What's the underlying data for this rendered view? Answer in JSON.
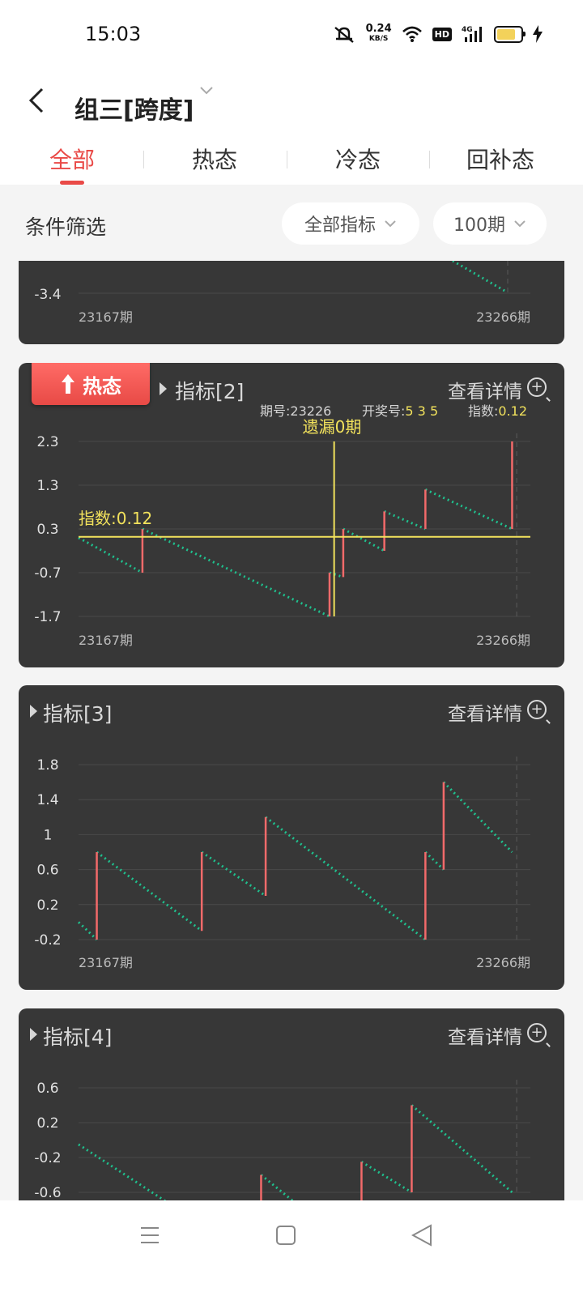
{
  "status_bar": {
    "time": "15:03",
    "net_speed": "0.24",
    "net_unit": "KB/S",
    "hd": "HD",
    "signal": "4G"
  },
  "header": {
    "back_icon": "chevron-left-icon",
    "title": "组三[跨度]"
  },
  "tabs": [
    {
      "label": "全部",
      "active": true
    },
    {
      "label": "热态",
      "active": false
    },
    {
      "label": "冷态",
      "active": false
    },
    {
      "label": "回补态",
      "active": false
    }
  ],
  "filter": {
    "label": "条件筛选",
    "indicator_select": "全部指标",
    "period_select": "100期"
  },
  "colors": {
    "accent": "#e94a47",
    "card_bg": "#373737",
    "line_green": "#1fc18e",
    "bar_red": "#f26a6a",
    "highlight_yellow": "#f2e25c"
  },
  "cards": [
    {
      "id": "card1",
      "partial": true,
      "yticks": [
        "-3.4"
      ],
      "x_start": "23167期",
      "x_end": "23266期"
    },
    {
      "id": "card2",
      "badge": "热态",
      "title": "指标[2]",
      "detail": "查看详情",
      "info": {
        "period_label": "期号:",
        "period": "23226",
        "draw_label": "开奖号:",
        "draw": "5 3 5",
        "index_label": "指数:",
        "index": "0.12"
      },
      "crosshair_label": "遗漏0期",
      "index_marker": "指数:0.12",
      "yticks": [
        "2.3",
        "1.3",
        "0.3",
        "-0.7",
        "-1.7"
      ],
      "x_start": "23167期",
      "x_end": "23266期"
    },
    {
      "id": "card3",
      "title": "指标[3]",
      "detail": "查看详情",
      "yticks": [
        "1.8",
        "1.4",
        "1",
        "0.6",
        "0.2",
        "-0.2"
      ],
      "x_start": "23167期",
      "x_end": "23266期"
    },
    {
      "id": "card4",
      "title": "指标[4]",
      "detail": "查看详情",
      "yticks": [
        "0.6",
        "0.2",
        "-0.2",
        "-0.6"
      ]
    }
  ],
  "chart_data": [
    {
      "type": "line",
      "chart": "指标[2]",
      "x_range": [
        "23167期",
        "23266期"
      ],
      "ylim": [
        -1.7,
        2.3
      ],
      "segments": [
        {
          "x": [
            0,
            14
          ],
          "y": [
            0.1,
            -0.7
          ]
        },
        {
          "x": [
            14,
            55
          ],
          "y": [
            0.3,
            -1.7
          ]
        },
        {
          "x": [
            55,
            58
          ],
          "y": [
            -0.7,
            -0.8
          ]
        },
        {
          "x": [
            58,
            67
          ],
          "y": [
            0.3,
            -0.2
          ]
        },
        {
          "x": [
            67,
            76
          ],
          "y": [
            0.7,
            0.3
          ]
        },
        {
          "x": [
            76,
            95
          ],
          "y": [
            1.2,
            0.3
          ]
        }
      ],
      "jumps": [
        {
          "x": 14,
          "from": -0.7,
          "to": 0.3
        },
        {
          "x": 55,
          "from": -1.7,
          "to": -0.7
        },
        {
          "x": 58,
          "from": -0.8,
          "to": 0.3
        },
        {
          "x": 67,
          "from": -0.2,
          "to": 0.7
        },
        {
          "x": 76,
          "from": 0.3,
          "to": 1.2
        },
        {
          "x": 95,
          "from": 0.3,
          "to": 2.3
        }
      ]
    },
    {
      "type": "line",
      "chart": "指标[3]",
      "x_range": [
        "23167期",
        "23266期"
      ],
      "ylim": [
        -0.2,
        1.8
      ],
      "segments": [
        {
          "x": [
            0,
            4
          ],
          "y": [
            0.0,
            -0.2
          ]
        },
        {
          "x": [
            4,
            27
          ],
          "y": [
            0.8,
            -0.1
          ]
        },
        {
          "x": [
            27,
            41
          ],
          "y": [
            0.8,
            0.3
          ]
        },
        {
          "x": [
            41,
            76
          ],
          "y": [
            1.2,
            -0.2
          ]
        },
        {
          "x": [
            76,
            80
          ],
          "y": [
            0.8,
            0.6
          ]
        },
        {
          "x": [
            80,
            95
          ],
          "y": [
            1.6,
            0.8
          ]
        }
      ],
      "jumps": [
        {
          "x": 4,
          "from": -0.2,
          "to": 0.8
        },
        {
          "x": 27,
          "from": -0.1,
          "to": 0.8
        },
        {
          "x": 41,
          "from": 0.3,
          "to": 1.2
        },
        {
          "x": 76,
          "from": -0.2,
          "to": 0.8
        },
        {
          "x": 80,
          "from": 0.6,
          "to": 1.6
        }
      ]
    },
    {
      "type": "line",
      "chart": "指标[4]",
      "ylim": [
        -0.6,
        0.6
      ],
      "segments": [
        {
          "x": [
            0,
            19
          ],
          "y": [
            -0.05,
            -0.7
          ]
        },
        {
          "x": [
            40,
            47
          ],
          "y": [
            -0.4,
            -0.7
          ]
        },
        {
          "x": [
            62,
            73
          ],
          "y": [
            -0.25,
            -0.6
          ]
        },
        {
          "x": [
            73,
            95
          ],
          "y": [
            0.4,
            -0.6
          ]
        }
      ],
      "jumps": [
        {
          "x": 40,
          "from": -0.8,
          "to": -0.4
        },
        {
          "x": 62,
          "from": -0.8,
          "to": -0.25
        },
        {
          "x": 73,
          "from": -0.6,
          "to": 0.4
        }
      ]
    }
  ]
}
